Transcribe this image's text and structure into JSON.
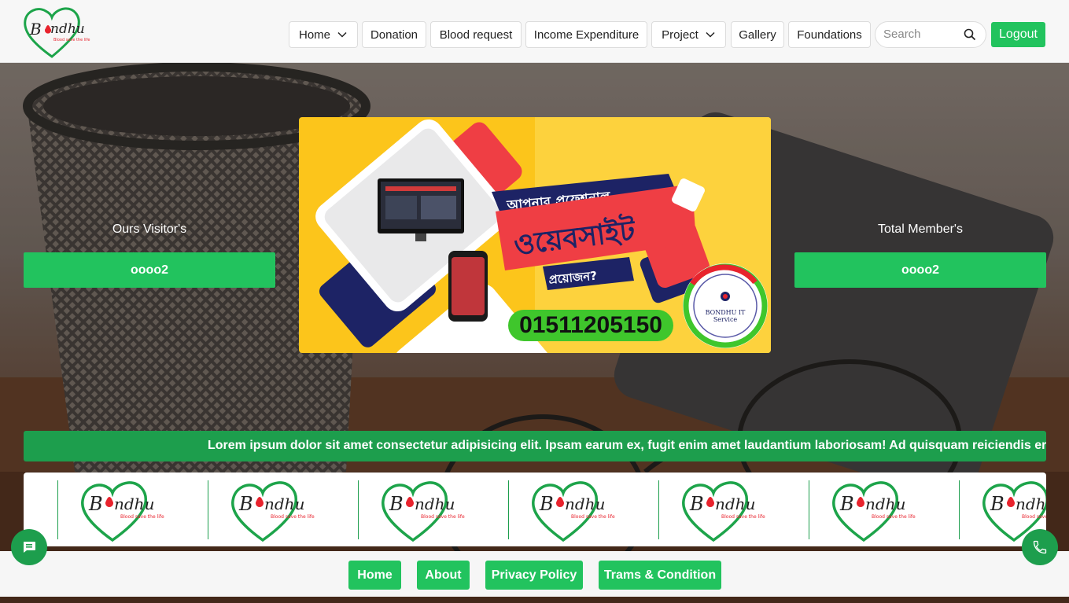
{
  "header": {
    "logo_text": "Bondhu",
    "logo_tagline": "Blood save the life",
    "nav": [
      {
        "label": "Home"
      },
      {
        "label": "Donation"
      },
      {
        "label": "Blood request"
      },
      {
        "label": "Income Expenditure"
      },
      {
        "label": "Project"
      },
      {
        "label": "Gallery"
      },
      {
        "label": "Foundations"
      }
    ],
    "search_placeholder": "Search",
    "logout_label": "Logout"
  },
  "stats": {
    "visitors_label": "Ours Visitor's",
    "visitors_value": "oooo2",
    "members_label": "Total Member's",
    "members_value": "oooo2"
  },
  "banner": {
    "headline_1": "আপনার প্রফেশনাল",
    "headline_2": "ওয়েবসাইট",
    "headline_3": "প্রয়োজন?",
    "phone": "01511205150",
    "badge_line1": "BONDHU IT",
    "badge_line2": "Service"
  },
  "ticker": {
    "text": "Lorem ipsum dolor sit amet consectetur adipisicing elit. Ipsam earum ex, fugit enim amet laudantium laboriosam! Ad quisquam reiciendis error? Lorem"
  },
  "footer": {
    "links": [
      {
        "label": "Home"
      },
      {
        "label": "About"
      },
      {
        "label": "Privacy Policy"
      },
      {
        "label": "Trams & Condition"
      }
    ]
  },
  "colors": {
    "brand_green": "#22c35e",
    "dark_green": "#1d9e4d",
    "brand_red": "#e8232d"
  },
  "icons": {
    "chat": "chat-icon",
    "phone": "phone-icon",
    "search": "search-icon",
    "chevron": "chevron-down-icon"
  }
}
